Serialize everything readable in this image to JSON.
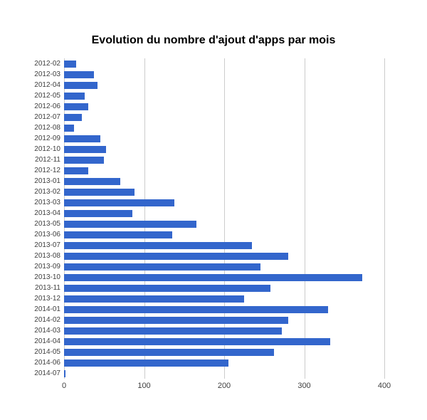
{
  "chart_data": {
    "type": "bar",
    "orientation": "horizontal",
    "title": "Evolution du nombre d'ajout d'apps par mois",
    "xlabel": "",
    "ylabel": "",
    "xlim": [
      0,
      400
    ],
    "xticks": [
      0,
      100,
      200,
      300,
      400
    ],
    "categories": [
      "2012-02",
      "2012-03",
      "2012-04",
      "2012-05",
      "2012-06",
      "2012-07",
      "2012-08",
      "2012-09",
      "2012-10",
      "2012-11",
      "2012-12",
      "2013-01",
      "2013-02",
      "2013-03",
      "2013-04",
      "2013-05",
      "2013-06",
      "2013-07",
      "2013-08",
      "2013-09",
      "2013-10",
      "2013-11",
      "2013-12",
      "2014-01",
      "2014-02",
      "2014-03",
      "2014-04",
      "2014-05",
      "2014-06",
      "2014-07"
    ],
    "values": [
      15,
      37,
      42,
      26,
      30,
      22,
      12,
      45,
      52,
      50,
      30,
      70,
      88,
      138,
      85,
      165,
      135,
      235,
      280,
      245,
      372,
      258,
      225,
      330,
      280,
      272,
      332,
      262,
      205,
      2
    ],
    "bar_color": "#3366cc"
  }
}
